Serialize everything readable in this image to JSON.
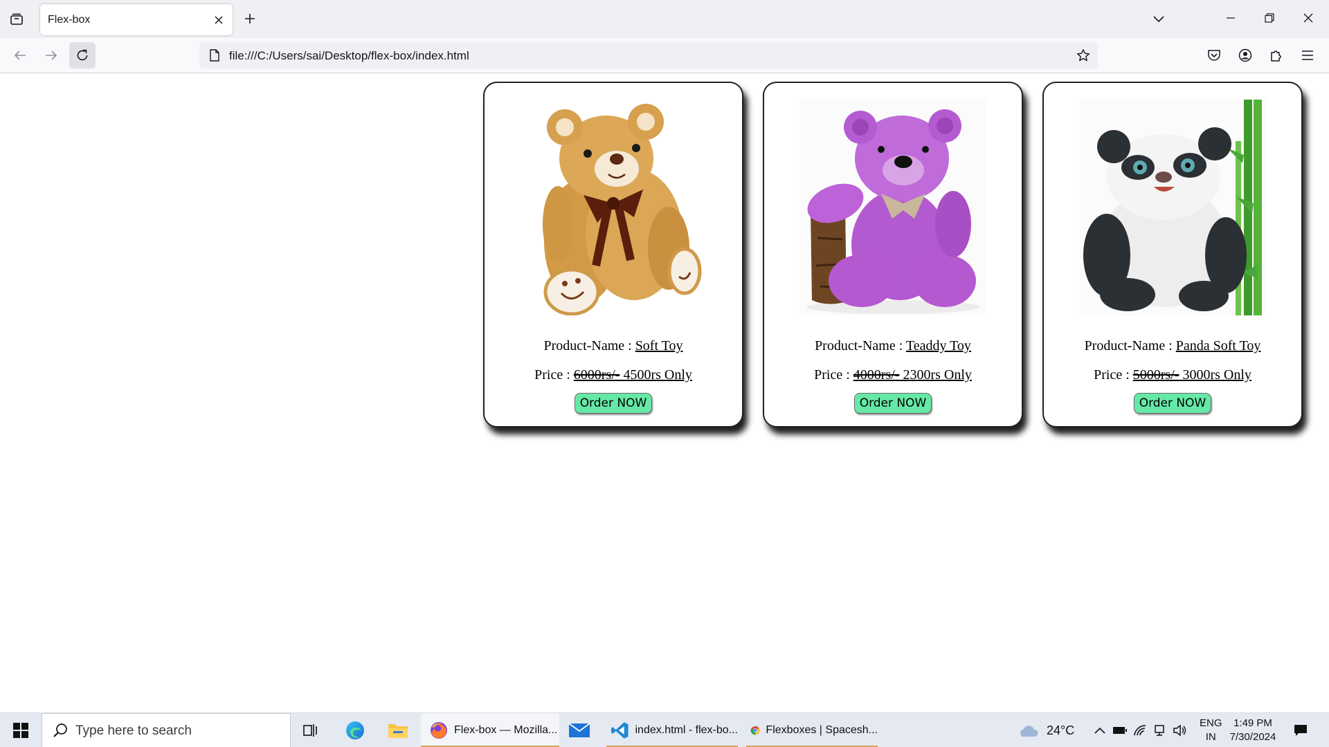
{
  "browser": {
    "tab_title": "Flex-box",
    "url": "file:///C:/Users/sai/Desktop/flex-box/index.html",
    "icons": [
      "tab-list-icon",
      "close-icon",
      "plus-icon",
      "chevron-down-icon",
      "minimize-icon",
      "restore-icon",
      "close-window-icon",
      "back-arrow-icon",
      "forward-arrow-icon",
      "reload-icon",
      "page-icon",
      "star-icon",
      "pocket-icon",
      "account-icon",
      "extensions-icon",
      "menu-icon"
    ]
  },
  "products": [
    {
      "name_label": "Product-Name : ",
      "name": "Soft Toy",
      "price_label": "Price : ",
      "old_price": "6000rs/-",
      "new_price": " 4500rs Only",
      "button": "Order NOW",
      "image": "golden-teddy-bear"
    },
    {
      "name_label": "Product-Name : ",
      "name": "Teaddy Toy",
      "price_label": "Price : ",
      "old_price": "4000rs/-",
      "new_price": " 2300rs Only",
      "button": "Order NOW",
      "image": "purple-teddy-bear"
    },
    {
      "name_label": "Product-Name : ",
      "name": "Panda Soft Toy",
      "price_label": "Price : ",
      "old_price": "5000rs/-",
      "new_price": " 3000rs Only",
      "button": "Order NOW",
      "image": "panda-with-bamboo"
    }
  ],
  "taskbar": {
    "search_placeholder": "Type here to search",
    "apps": [
      {
        "label": "Flex-box — Mozilla...",
        "icon": "firefox-icon"
      },
      {
        "label": "index.html - flex-bo...",
        "icon": "vscode-icon"
      },
      {
        "label": "Flexboxes | Spacesh...",
        "icon": "chrome-icon"
      }
    ],
    "weather_temp": "24°C",
    "language": "ENG",
    "region": "IN",
    "time": "1:49 PM",
    "date": "7/30/2024"
  },
  "colors": {
    "order_button": "#66e8a6",
    "tab_strip": "#f0f0f4",
    "taskbar": "#e5e9f1",
    "running_indicator": "#d9a255"
  }
}
